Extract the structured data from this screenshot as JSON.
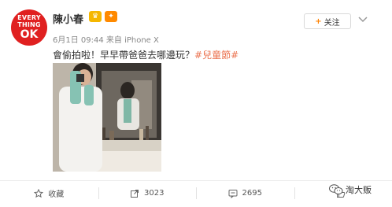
{
  "author": {
    "avatar_text": [
      "EVERY",
      "THING",
      "OK"
    ],
    "name": "陳小春"
  },
  "follow_button": {
    "label": "关注"
  },
  "meta": {
    "text": "6月1日 09:44 来自 iPhone X"
  },
  "post": {
    "text": "會偷拍啦！早早帶爸爸去哪邊玩？",
    "hashtag": "#兒童節#"
  },
  "actions": [
    {
      "icon": "star-icon",
      "label": "收藏"
    },
    {
      "icon": "share-icon",
      "label": "3023"
    },
    {
      "icon": "comment-icon",
      "label": "2695"
    },
    {
      "icon": "like-icon",
      "label": ""
    }
  ],
  "watermark": {
    "text": "淘大贩"
  },
  "colors": {
    "avatar": "#e02020",
    "accent": "#ff8200",
    "hashtag": "#eb7350"
  }
}
